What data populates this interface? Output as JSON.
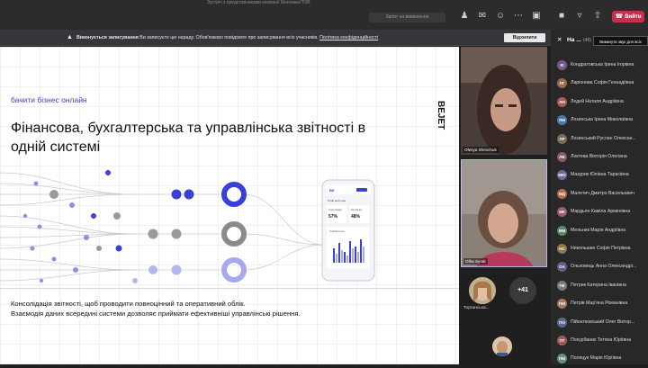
{
  "window": {
    "title_strip": "Зустріч з представниками компанії Мономах/ТОВ",
    "join_hint": "Запит на ввімкнення",
    "leave_label": "Вийти",
    "colors": {
      "accent": "#3b3fd6",
      "leave": "#c4314b",
      "teams_bg": "#201f1f"
    }
  },
  "toolbar": {
    "icons": [
      "people-icon",
      "chat-icon",
      "reaction-icon",
      "more-icon",
      "camera-off-icon",
      "mic-icon",
      "share-icon"
    ]
  },
  "banner": {
    "bold": "Виконується записування",
    "text": "Ви записуєте цю нараду. Обов'язково повідомте про записування всіх учасників.",
    "link": "Політика конфіденційності",
    "dismiss": "Відхилити"
  },
  "slide": {
    "kicker": "бачити бізнес онлайн",
    "headline": "Фінансова, бухгалтерська та управлінська звітності в одній системі",
    "brand": "BEJET",
    "caption_line1": "Консолідація звітності, щоб проводити повноцінний та оперативний облік.",
    "caption_line2": "Взаємодія даних всередині системи дозволяє приймати ефективніші управлінські рішення.",
    "phone": {
      "logo": "BE",
      "section": "Profit and Loss",
      "gross_margin_label": "Gross Margin",
      "gross_margin_value": "57%",
      "net_margin_label": "Net Margin",
      "net_margin_value": "48%",
      "chart_label": "Total Revenue"
    }
  },
  "video": {
    "tile1_name": "Olesya Shevchuk",
    "tile2_name": "Olha Syrak",
    "thumb1_name": "Торганська...",
    "more_count": "+41"
  },
  "sidebar": {
    "title": "На ...",
    "count": "(45)",
    "tooltip": "Вимкнути звук для всіх",
    "participants": [
      {
        "initials": "КІ",
        "name": "Кондратовська Ірина Ігорівна",
        "color": "#7a5a8a"
      },
      {
        "initials": "ЛГ",
        "name": "Ларіонова Софія Геннадіївна",
        "color": "#9a6a4a"
      },
      {
        "initials": "ЛН",
        "name": "Ледей Наталя Андріївна",
        "color": "#a85a5a"
      },
      {
        "initials": "ЛМ",
        "name": "Лозинська Ірина Миколаївна",
        "color": "#4a7aa8"
      },
      {
        "initials": "ЛР",
        "name": "Лозинський Руслан Олексан...",
        "color": "#7a6a5a"
      },
      {
        "initials": "ЛВ",
        "name": "Локтева Вікторія Олегівна",
        "color": "#8a5a6a"
      },
      {
        "initials": "МЮ",
        "name": "Мазурик Юліана Тарасівна",
        "color": "#6a6a9a"
      },
      {
        "initials": "МД",
        "name": "Малетич Дмитро Васильович",
        "color": "#b86a4a"
      },
      {
        "initials": "МК",
        "name": "Мардьян Каміла Арменівна",
        "color": "#9a5a7a"
      },
      {
        "initials": "ММ",
        "name": "Мельник Марія Андріївна",
        "color": "#5a8a6a"
      },
      {
        "initials": "НС",
        "name": "Никольшин Софія Петрівна",
        "color": "#8a7a4a"
      },
      {
        "initials": "ОА",
        "name": "Ольховець Анна Олександрі...",
        "color": "#6a5a8a"
      },
      {
        "initials": "ПК",
        "name": "Петрик Катерина Іванівна",
        "color": "#7a7a7a"
      },
      {
        "initials": "ПМ",
        "name": "Петрів Мар'яна Романівна",
        "color": "#a87a5a"
      },
      {
        "initials": "ПО",
        "name": "Пійонтковський Олег Віктор...",
        "color": "#5a6a8a"
      },
      {
        "initials": "ПТ",
        "name": "Похурбаник Тетяна Юріївна",
        "color": "#9a5a5a"
      },
      {
        "initials": "ПМ",
        "name": "Поляцук Марія Юріївна",
        "color": "#6a8a8a"
      }
    ]
  }
}
